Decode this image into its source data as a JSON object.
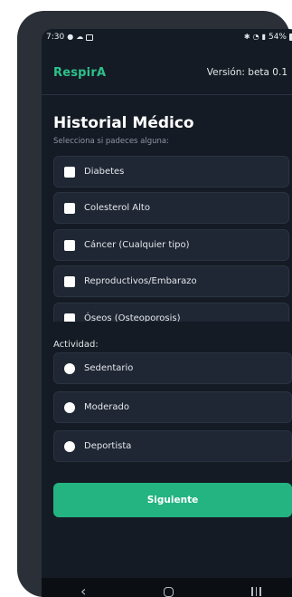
{
  "statusbar": {
    "time": "7:30",
    "battery": "54%"
  },
  "app": {
    "name": "RespirA",
    "version": "Versión: beta 0.1"
  },
  "history": {
    "title": "Historial Médico",
    "subtitle": "Selecciona si padeces alguna:",
    "conditions": [
      {
        "label": "Diabetes",
        "checked": false
      },
      {
        "label": "Colesterol Alto",
        "checked": false
      },
      {
        "label": "Cáncer (Cualquier tipo)",
        "checked": false
      },
      {
        "label": "Reproductivos/Embarazo",
        "checked": false
      },
      {
        "label": "Óseos (Osteoporosis)",
        "checked": false
      }
    ]
  },
  "activity": {
    "label": "Actividad:",
    "options": [
      {
        "label": "Sedentario",
        "selected": false
      },
      {
        "label": "Moderado",
        "selected": false
      },
      {
        "label": "Deportista",
        "selected": false
      }
    ]
  },
  "actions": {
    "next_label": "Siguiente"
  },
  "colors": {
    "accent": "#23b482",
    "logo": "#2ec08b",
    "background": "#141b24",
    "card": "#1f2734"
  },
  "icons": {
    "status_left": [
      "facebook-icon",
      "cloud-icon",
      "image-icon"
    ],
    "status_right": [
      "bluetooth-icon",
      "wifi-icon",
      "signal-icon",
      "battery-icon"
    ],
    "nav": [
      "back-icon",
      "home-icon",
      "recent-apps-icon"
    ]
  }
}
